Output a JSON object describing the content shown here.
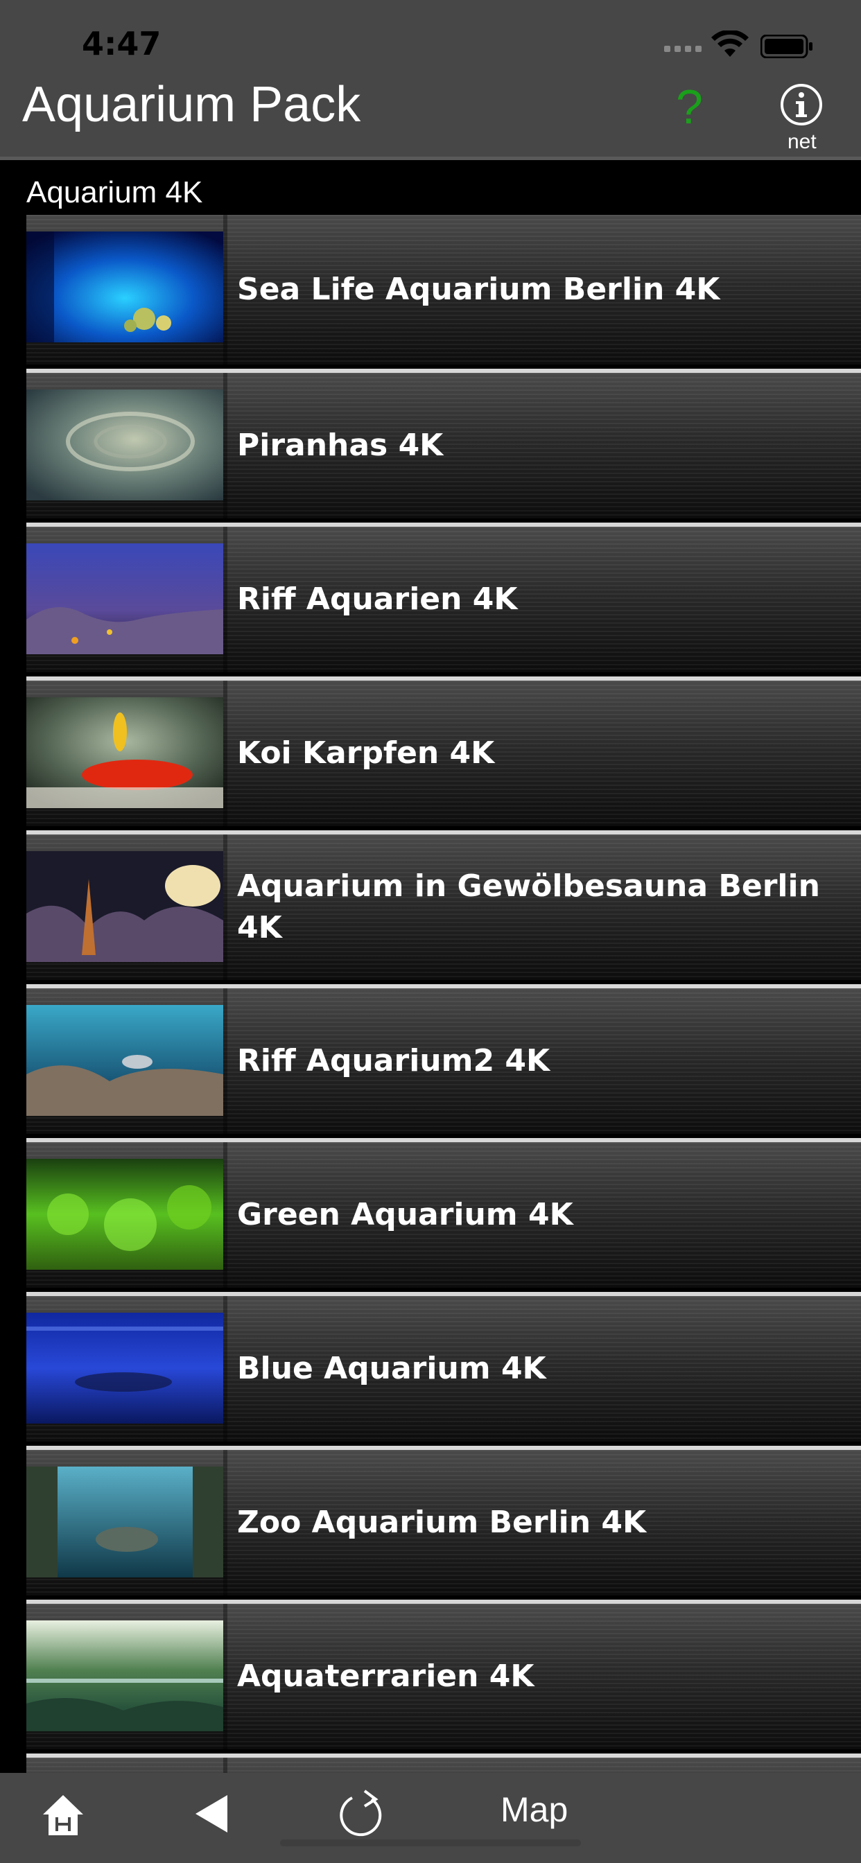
{
  "status_bar": {
    "time": "4:47"
  },
  "nav": {
    "title": "Aquarium Pack",
    "help_label": "?",
    "info_sub_label": "net"
  },
  "section": {
    "title": "Aquarium 4K"
  },
  "items": [
    {
      "label": "Sea Life Aquarium Berlin 4K",
      "thumb": "blue-aquarium-thumbnail"
    },
    {
      "label": "Piranhas 4K",
      "thumb": "piranha-swirl-thumbnail"
    },
    {
      "label": "Riff Aquarien 4K",
      "thumb": "reef-thumbnail"
    },
    {
      "label": "Koi Karpfen 4K",
      "thumb": "koi-thumbnail"
    },
    {
      "label": "Aquarium in Gewölbesauna Berlin 4K",
      "thumb": "coral-thumbnail"
    },
    {
      "label": "Riff Aquarium2 4K",
      "thumb": "reef2-thumbnail"
    },
    {
      "label": "Green Aquarium 4K",
      "thumb": "green-plants-thumbnail"
    },
    {
      "label": "Blue Aquarium 4K",
      "thumb": "blue-tank-thumbnail"
    },
    {
      "label": "Zoo Aquarium Berlin 4K",
      "thumb": "zoo-aquarium-thumbnail"
    },
    {
      "label": "Aquaterrarien 4K",
      "thumb": "aquaterrarium-thumbnail"
    },
    {
      "label": "",
      "thumb": "partial-thumbnail"
    }
  ],
  "toolbar": {
    "map_label": "Map"
  },
  "colors": {
    "bar_bg": "#474747",
    "help_green": "#1aa01a",
    "row_separator": "#d8d8d8"
  }
}
